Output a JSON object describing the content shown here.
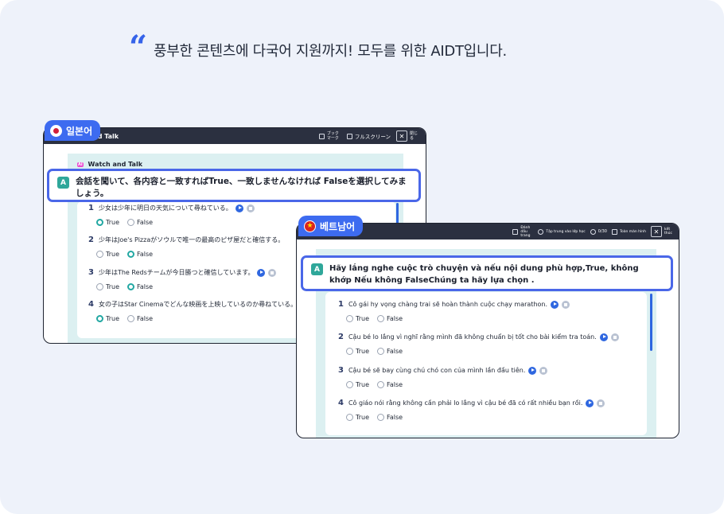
{
  "headline": {
    "quote_mark": "“",
    "text": "풍부한 콘텐츠에 다국어 지원까지! 모두를 위한 AIDT입니다."
  },
  "japanese": {
    "tag_label": "일본어",
    "window_title": "nd Talk",
    "toolbar": {
      "bookmark": "ブックマーク",
      "fullscreen": "フルスクリーン",
      "close": "閉じる"
    },
    "section_title": "Watch and Talk",
    "ai_badge": "AI",
    "instruction_badge": "A",
    "instruction": "会話を聞いて、各内容と一致すればTrue、一致しませんなければ Falseを選択してみましょう。",
    "questions": [
      {
        "num": "1",
        "text": "少女は少年に明日の天気について尋ねている。",
        "selected": "True"
      },
      {
        "num": "2",
        "text": "少年はJoe's Pizzaがソウルで唯一の最高のピザ屋だと確信する。",
        "selected": "False"
      },
      {
        "num": "3",
        "text": "少年はThe Redsチームが今日勝つと確信しています。",
        "selected": "False"
      },
      {
        "num": "4",
        "text": "女の子はStar Cinemaでどんな映画を上映しているのか尋ねている。",
        "selected": "True"
      }
    ],
    "true_label": "True",
    "false_label": "False"
  },
  "vietnamese": {
    "tag_label": "베트남어",
    "toolbar": {
      "bookmark": "Đánh dấu trang",
      "focus": "Tập trung vào lớp học",
      "counter": "0/30",
      "fullscreen": "Toàn màn hình",
      "close": "kết thúc"
    },
    "instruction_badge": "A",
    "instruction": "Hãy lắng nghe cuộc trò chuyện và nếu nội dung phù hợp,True, không khớp Nếu không FalseChúng ta hãy lựa chọn .",
    "questions": [
      {
        "num": "1",
        "text": "Cô gái hy vọng chàng trai sẽ hoàn thành cuộc chạy marathon."
      },
      {
        "num": "2",
        "text": "Cậu bé lo lắng vì nghĩ rằng mình đã không chuẩn bị tốt cho bài kiểm tra toán."
      },
      {
        "num": "3",
        "text": "Cậu bé sẽ bay cùng chú chó con của mình lần đầu tiên."
      },
      {
        "num": "4",
        "text": "Cô giáo nói rằng không cần phải lo lắng vì cậu bé đã có rất nhiều bạn rồi."
      }
    ],
    "true_label": "True",
    "false_label": "False"
  }
}
